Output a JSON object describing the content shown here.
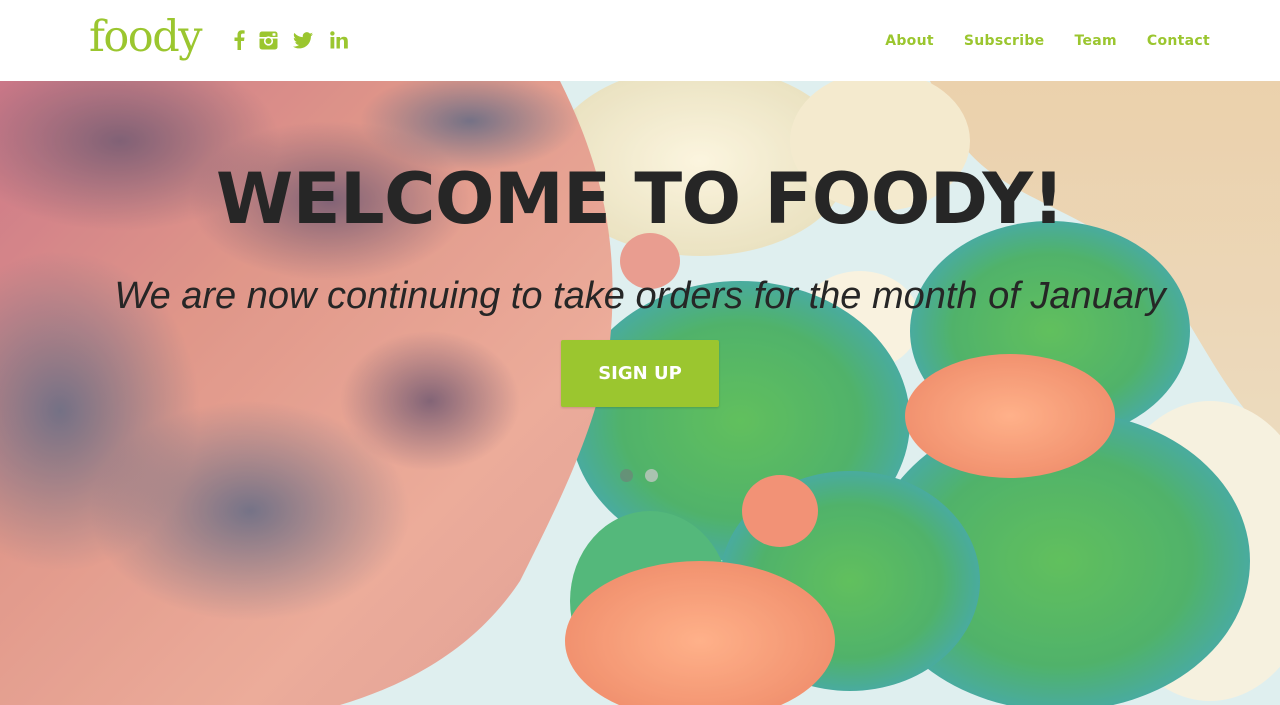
{
  "brand": {
    "logo_text": "foody",
    "accent_color": "#9bc62f"
  },
  "social_links": [
    {
      "icon": "facebook-icon"
    },
    {
      "icon": "instagram-icon"
    },
    {
      "icon": "twitter-icon"
    },
    {
      "icon": "linkedin-icon"
    }
  ],
  "nav": {
    "items": [
      {
        "label": "About"
      },
      {
        "label": "Subscribe"
      },
      {
        "label": "Team"
      },
      {
        "label": "Contact"
      }
    ]
  },
  "hero": {
    "title": "WELCOME TO FOODY!",
    "subtitle": "We are now continuing to take orders for the month of January",
    "cta_label": "SIGN UP",
    "title_color": "#262626",
    "slides": {
      "count": 2,
      "active": 1
    }
  }
}
